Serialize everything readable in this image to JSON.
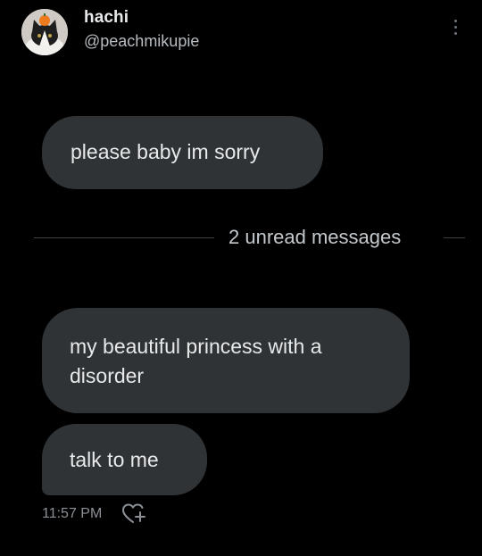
{
  "header": {
    "display_name": "hachi",
    "handle": "@peachmikupie"
  },
  "messages": [
    {
      "text": "please baby im sorry"
    },
    {
      "text": "my beautiful princess with a disorder"
    },
    {
      "text": "talk to me"
    }
  ],
  "divider": {
    "label": "2 unread messages"
  },
  "footer": {
    "timestamp": "11:57 PM"
  },
  "icons": {
    "more": "more-vertical-icon",
    "reaction": "heart-add-icon"
  },
  "colors": {
    "background": "#000000",
    "bubble": "#2f3336",
    "text": "#e7e9ea",
    "secondary_text": "#b7bcc1",
    "timestamp": "#8b9096"
  }
}
